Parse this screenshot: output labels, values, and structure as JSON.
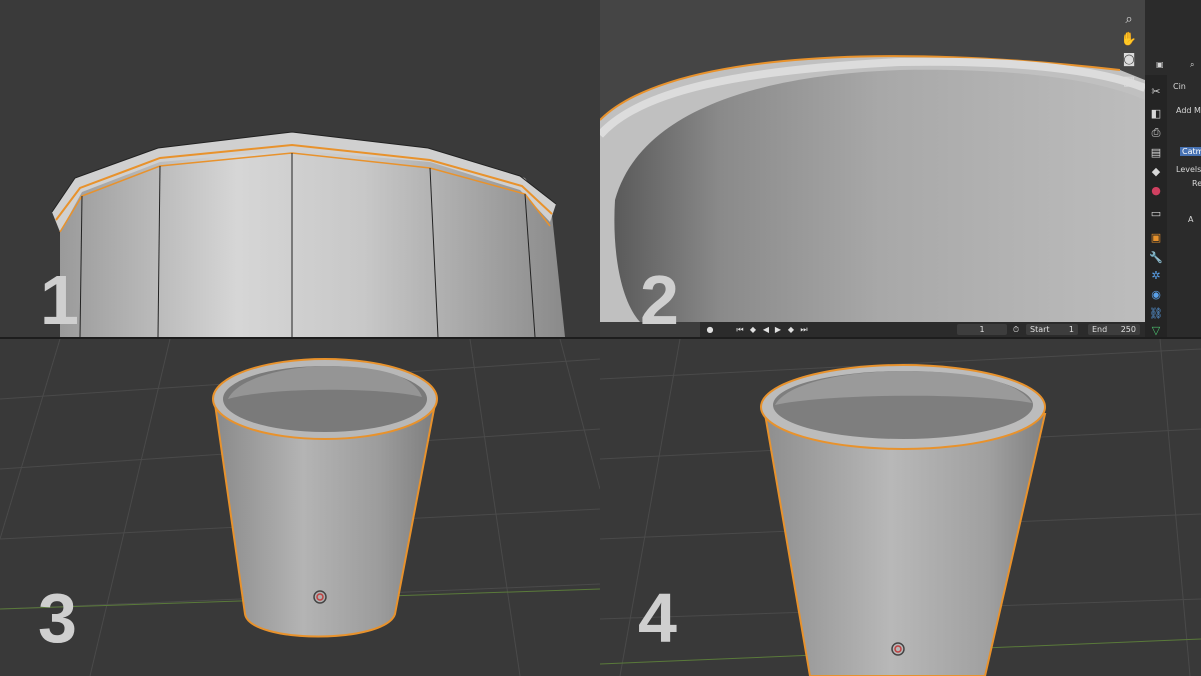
{
  "panels": [
    {
      "id": "p1",
      "label": "1"
    },
    {
      "id": "p2",
      "label": "2"
    },
    {
      "id": "p3",
      "label": "3"
    },
    {
      "id": "p4",
      "label": "4"
    }
  ],
  "viewport_tools": [
    {
      "name": "zoom-icon",
      "glyph": "⌕"
    },
    {
      "name": "pan-hand-icon",
      "glyph": "✋"
    },
    {
      "name": "camera-icon",
      "glyph": "🎥"
    },
    {
      "name": "grid-icon",
      "glyph": "▦"
    }
  ],
  "properties": {
    "header_icon": "view-mode-icon",
    "search_icon": "search-icon",
    "object_name": "Cin",
    "add_modifier": "Add Mo",
    "subdivision_type": "Catm",
    "levels_label": "Levels",
    "render_label": "Re",
    "advanced_label": "A"
  },
  "property_tabs": [
    "tool-icon",
    "render-icon",
    "output-icon",
    "view-layer-icon",
    "scene-icon",
    "world-icon",
    "collection-icon",
    "object-icon",
    "modifier-wrench-icon",
    "particles-icon",
    "physics-icon",
    "constraints-icon",
    "data-icon"
  ],
  "timeline": {
    "current_frame": "1",
    "start_label": "Start",
    "start_value": "1",
    "end_label": "End",
    "end_value": "250"
  },
  "colors": {
    "selection_outline": "#e8922c",
    "background_dark": "#393939",
    "active_tab": "#4772b3"
  }
}
